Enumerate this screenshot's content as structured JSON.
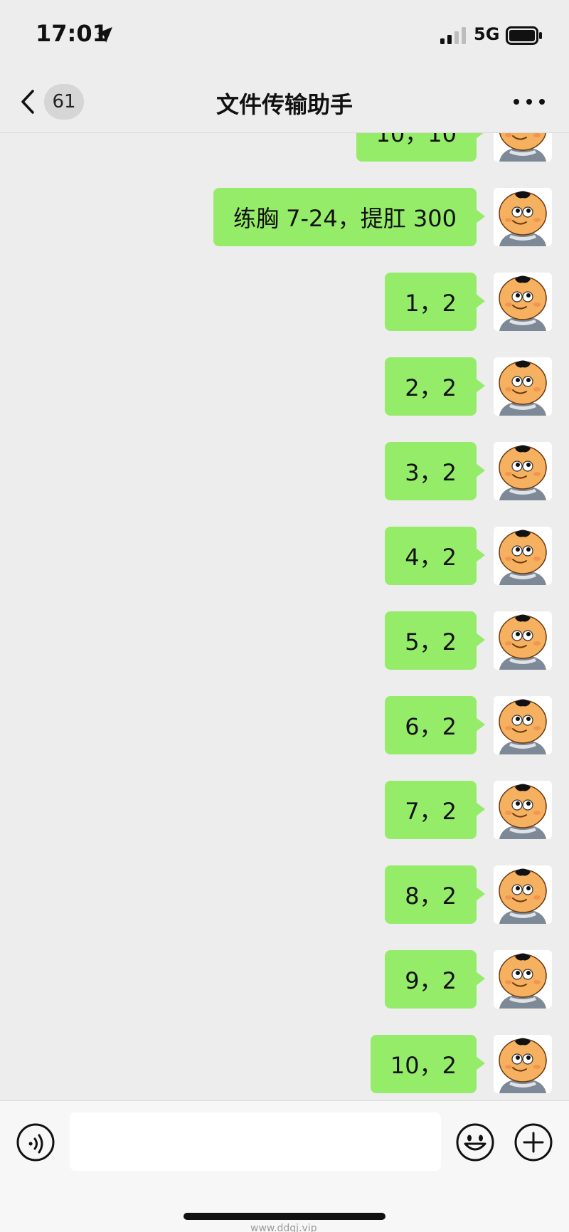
{
  "status_bar": {
    "time": "17:01",
    "network": "5G",
    "icons": [
      "location-arrow-icon",
      "signal-bars-icon",
      "battery-icon"
    ]
  },
  "nav": {
    "back_icon": "chevron-left-icon",
    "unread_count": "61",
    "title": "文件传输助手",
    "more_icon": "ellipsis-icon"
  },
  "messages": [
    {
      "text": "10，10"
    },
    {
      "text": "练胸 7-24，提肛 300"
    },
    {
      "text": "1，2"
    },
    {
      "text": "2，2"
    },
    {
      "text": "3，2"
    },
    {
      "text": "4，2"
    },
    {
      "text": "5，2"
    },
    {
      "text": "6，2"
    },
    {
      "text": "7，2"
    },
    {
      "text": "8，2"
    },
    {
      "text": "9，2"
    },
    {
      "text": "10，2"
    }
  ],
  "input_bar": {
    "voice_icon": "voice-icon",
    "input_value": "",
    "emoji_icon": "emoji-icon",
    "plus_icon": "plus-icon"
  },
  "watermark": "www.ddqj.vip",
  "colors": {
    "background": "#ededed",
    "bubble_green": "#95ec69",
    "input_bar": "#f7f7f7"
  }
}
